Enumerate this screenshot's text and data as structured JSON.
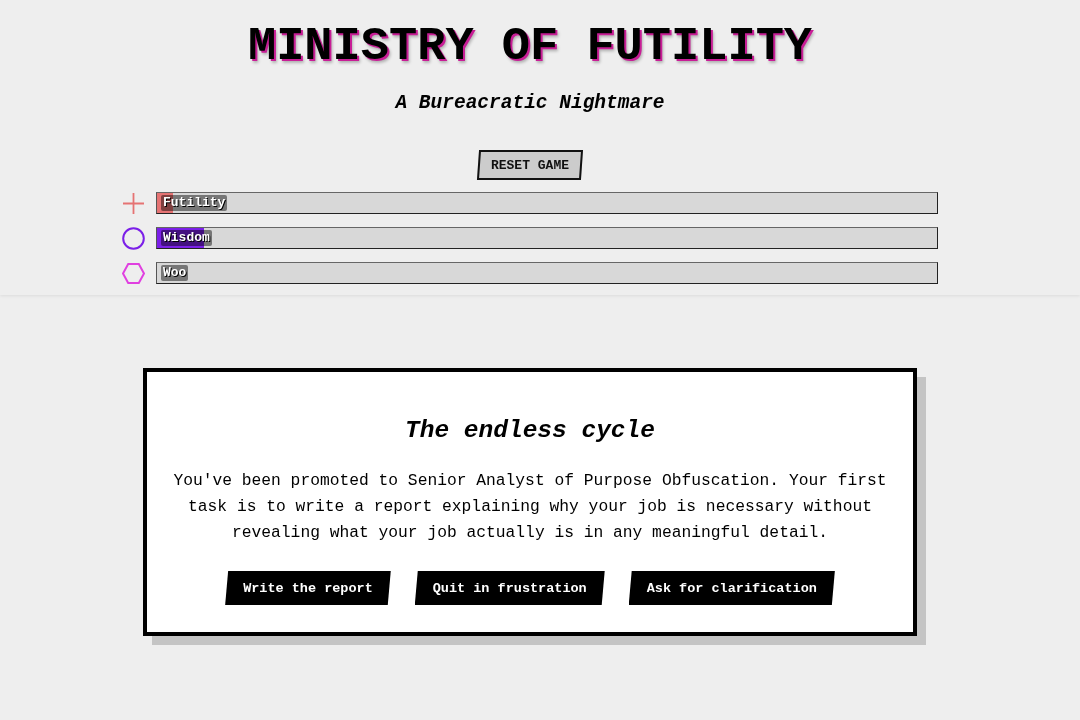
{
  "title": "MINISTRY OF FUTILITY",
  "subtitle": "A Bureacratic Nightmare",
  "reset_button": {
    "label": "RESET GAME"
  },
  "meters": [
    {
      "label": "Futility",
      "kind": "cross",
      "color": "#e57373",
      "level": 0.02
    },
    {
      "label": "Wisdom",
      "kind": "circle",
      "color": "#7b1fe8",
      "level": 0.06
    },
    {
      "label": "Woo",
      "kind": "hexagon",
      "color": "#e040e0"
    }
  ],
  "card": {
    "heading": "The endless cycle",
    "body": "You've been promoted to Senior Analyst of Purpose Obfuscation. Your first task is to write a report explaining why your job is necessary without revealing what your job actually is in any meaningful detail.",
    "choices": [
      "Write the report",
      "Quit in frustration",
      "Ask for clarification"
    ]
  }
}
